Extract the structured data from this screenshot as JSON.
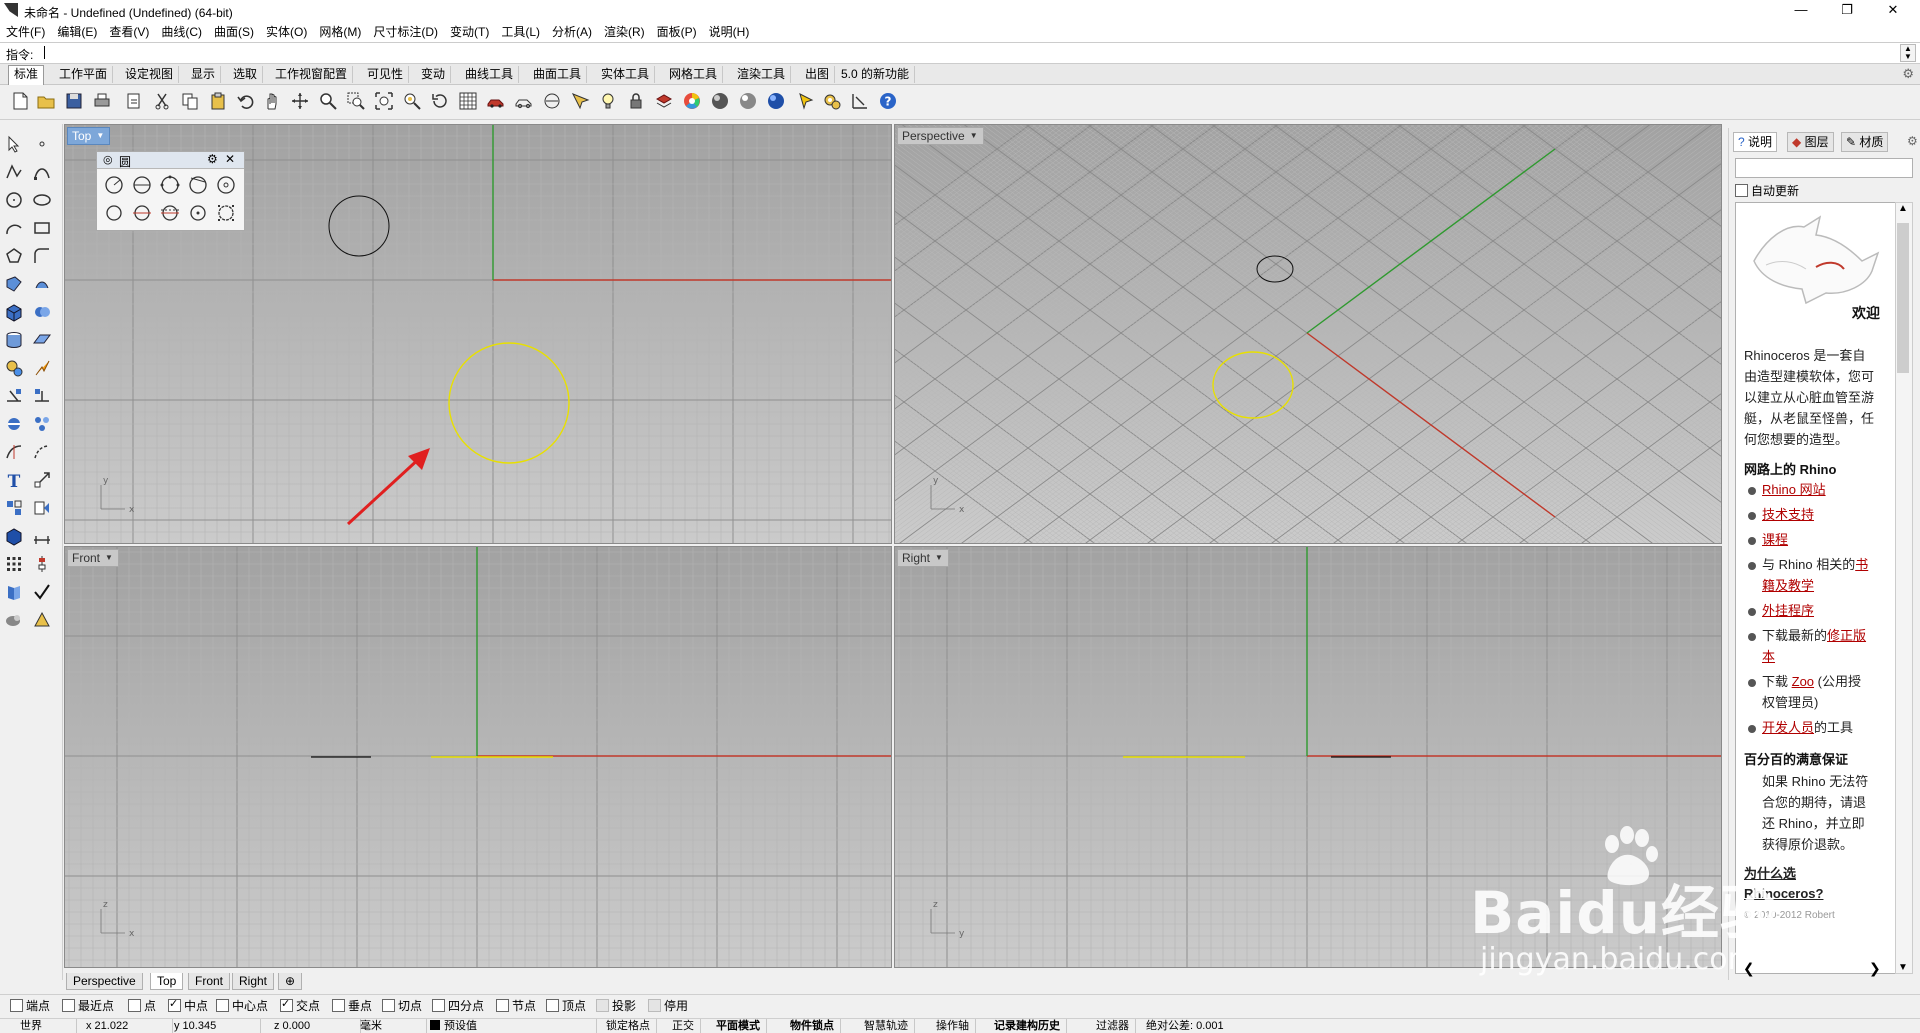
{
  "window": {
    "title": "未命名 - Undefined (Undefined) (64-bit)",
    "minimize": "—",
    "maximize": "❐",
    "close": "✕"
  },
  "menu": [
    "文件(F)",
    "编辑(E)",
    "查看(V)",
    "曲线(C)",
    "曲面(S)",
    "实体(O)",
    "网格(M)",
    "尺寸标注(D)",
    "变动(T)",
    "工具(L)",
    "分析(A)",
    "渲染(R)",
    "面板(P)",
    "说明(H)"
  ],
  "command": {
    "label": "指令:",
    "value": ""
  },
  "toolbar_tabs": [
    "标准",
    "工作平面",
    "设定视图",
    "显示",
    "选取",
    "工作视窗配置",
    "可见性",
    "变动",
    "曲线工具",
    "曲面工具",
    "实体工具",
    "网格工具",
    "渲染工具",
    "出图",
    "5.0 的新功能"
  ],
  "toolbar_active_tab": "标准",
  "viewports": {
    "top": {
      "label": "Top",
      "active": true
    },
    "perspective": {
      "label": "Perspective",
      "active": false
    },
    "front": {
      "label": "Front",
      "active": false
    },
    "right": {
      "label": "Right",
      "active": false
    }
  },
  "circle_panel": {
    "title": "圆"
  },
  "viewport_tabs": [
    "Perspective",
    "Top",
    "Front",
    "Right"
  ],
  "viewport_tab_active": "Top",
  "osnaps": [
    {
      "label": "端点",
      "checked": false
    },
    {
      "label": "最近点",
      "checked": false
    },
    {
      "label": "点",
      "checked": false
    },
    {
      "label": "中点",
      "checked": true
    },
    {
      "label": "中心点",
      "checked": false
    },
    {
      "label": "交点",
      "checked": true
    },
    {
      "label": "垂点",
      "checked": false
    },
    {
      "label": "切点",
      "checked": false
    },
    {
      "label": "四分点",
      "checked": false
    },
    {
      "label": "节点",
      "checked": false
    },
    {
      "label": "顶点",
      "checked": false
    },
    {
      "label": "投影",
      "checked": false
    },
    {
      "label": "停用",
      "checked": false
    }
  ],
  "status": {
    "cplane": "世界",
    "x": "x 21.022",
    "y": "y 10.345",
    "z": "z 0.000",
    "units": "毫米",
    "layer": "预设值",
    "grid_snap": "锁定格点",
    "ortho": "正交",
    "planar": "平面模式",
    "osnap": "物件锁点",
    "smarttrack": "智慧轨迹",
    "gumball": "操作轴",
    "history": "记录建构历史",
    "filter": "过滤器",
    "tolerance": "绝对公差: 0.001"
  },
  "right_panel": {
    "tabs": [
      "说明",
      "图层",
      "材质"
    ],
    "active_tab": "说明",
    "auto_update": "自动更新",
    "welcome": "欢迎",
    "intro": [
      "Rhinoceros 是一套自",
      "由造型建模软体，您可",
      "以建立从心脏血管至游",
      "艇，从老鼠至怪兽，任",
      "何您想要的造型。"
    ],
    "online_heading": "网路上的 Rhino",
    "links": [
      {
        "prefix": "",
        "link": "Rhino 网站",
        "suffix": ""
      },
      {
        "prefix": "",
        "link": "技术支持",
        "suffix": ""
      },
      {
        "prefix": "",
        "link": "课程",
        "suffix": ""
      },
      {
        "prefix": "与 Rhino 相关的",
        "link": "书",
        "suffix": ""
      },
      {
        "prefix": "",
        "link": "籍及教学",
        "suffix": ""
      },
      {
        "prefix": "",
        "link": "外挂程序",
        "suffix": ""
      },
      {
        "prefix": "下载最新的",
        "link": "修正版",
        "suffix": ""
      },
      {
        "prefix": "",
        "link": "本",
        "suffix": ""
      },
      {
        "prefix": "下载 ",
        "link": "Zoo",
        "suffix": " (公用授"
      },
      {
        "prefix": "权管理员)",
        "link": "",
        "suffix": ""
      },
      {
        "prefix": "",
        "link": "开发人员",
        "suffix": "的工具"
      }
    ],
    "guarantee_heading": "百分百的满意保证",
    "guarantee": [
      "如果 Rhino 无法符",
      "合您的期待，请退",
      "还 Rhino，并立即",
      "获得原价退款。"
    ],
    "why_link_1": "为什么选",
    "why_link_2": "Rhinoceros?",
    "copyright": "© 2010-2012 Robert"
  },
  "watermark": {
    "main": "Baidu经验",
    "url": "jingyan.baidu.com"
  },
  "colors": {
    "x_axis": "#c0392b",
    "y_axis": "#2f9a2f",
    "selected": "#e8e000",
    "active_label": "#7da7d9",
    "annotation_arrow": "#e02020"
  }
}
